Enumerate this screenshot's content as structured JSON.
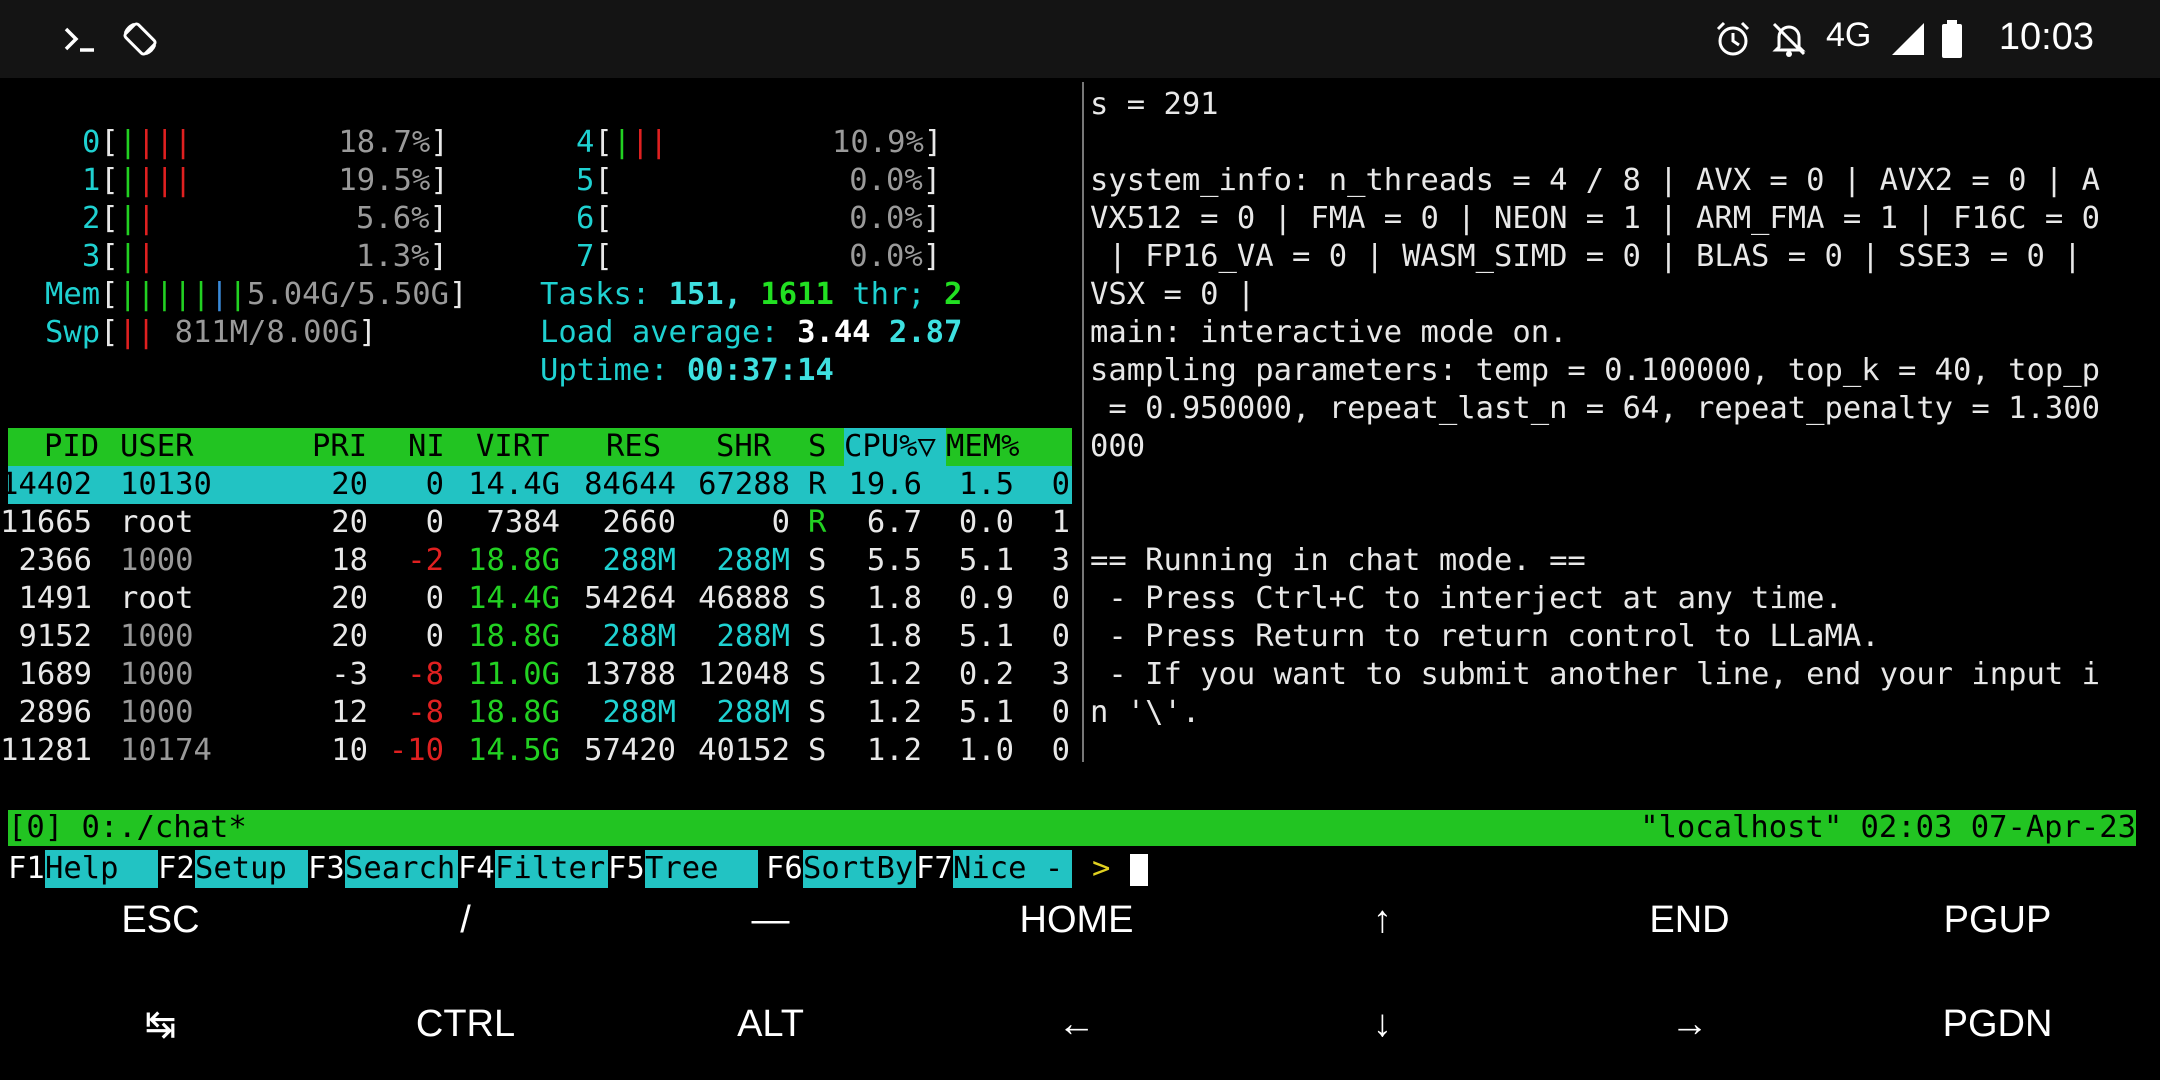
{
  "status_bar": {
    "left_icons": [
      "terminal-icon",
      "screen-rotate-icon"
    ],
    "right_icons": [
      "alarm-icon",
      "notifications-off-icon",
      "signal-icon",
      "battery-icon"
    ],
    "network": "4G",
    "time": "10:03"
  },
  "htop": {
    "cpus": [
      {
        "id": "0",
        "bars": "||||",
        "pct": "18.7%"
      },
      {
        "id": "1",
        "bars": "||||",
        "pct": "19.5%"
      },
      {
        "id": "2",
        "bars": "||",
        "pct": "5.6%"
      },
      {
        "id": "3",
        "bars": "||",
        "pct": "1.3%"
      },
      {
        "id": "4",
        "bars": "|||",
        "pct": "10.9%"
      },
      {
        "id": "5",
        "bars": "",
        "pct": "0.0%"
      },
      {
        "id": "6",
        "bars": "",
        "pct": "0.0%"
      },
      {
        "id": "7",
        "bars": "",
        "pct": "0.0%"
      }
    ],
    "mem": {
      "label": "Mem",
      "bars": "|||||||",
      "value": "5.04G/5.50G"
    },
    "swp": {
      "label": "Swp",
      "bars": "||",
      "value": "811M/8.00G"
    },
    "tasks": {
      "label": "Tasks:",
      "count": "151,",
      "thr": "1611",
      "thr_label": "thr;",
      "running": "2"
    },
    "load": {
      "label": "Load average:",
      "v1": "3.44",
      "v2": "2.87"
    },
    "uptime": {
      "label": "Uptime:",
      "value": "00:37:14"
    },
    "columns": [
      "PID",
      "USER",
      "PRI",
      "NI",
      "VIRT",
      "RES",
      "SHR",
      "S",
      "CPU%▽",
      "MEM%"
    ],
    "rows": [
      [
        "14402",
        "10130",
        "20",
        "0",
        "14.4G",
        "84644",
        "67288",
        "R",
        "19.6",
        "1.5",
        "0"
      ],
      [
        "11665",
        "root",
        "20",
        "0",
        "7384",
        "2660",
        "0",
        "R",
        "6.7",
        "0.0",
        "1"
      ],
      [
        "2366",
        "1000",
        "18",
        "-2",
        "18.8G",
        "288M",
        "288M",
        "S",
        "5.5",
        "5.1",
        "3"
      ],
      [
        "1491",
        "root",
        "20",
        "0",
        "14.4G",
        "54264",
        "46888",
        "S",
        "1.8",
        "0.9",
        "0"
      ],
      [
        "9152",
        "1000",
        "20",
        "0",
        "18.8G",
        "288M",
        "288M",
        "S",
        "1.8",
        "5.1",
        "0"
      ],
      [
        "1689",
        "1000",
        "-3",
        "-8",
        "11.0G",
        "13788",
        "12048",
        "S",
        "1.2",
        "0.2",
        "3"
      ],
      [
        "2896",
        "1000",
        "12",
        "-8",
        "18.8G",
        "288M",
        "288M",
        "S",
        "1.2",
        "5.1",
        "0"
      ],
      [
        "11281",
        "10174",
        "10",
        "-10",
        "14.5G",
        "57420",
        "40152",
        "S",
        "1.2",
        "1.0",
        "0"
      ]
    ],
    "fkeys": [
      {
        "key": "F1",
        "label": "Help  "
      },
      {
        "key": "F2",
        "label": "Setup "
      },
      {
        "key": "F3",
        "label": "Search"
      },
      {
        "key": "F4",
        "label": "Filter"
      },
      {
        "key": "F5",
        "label": "Tree  "
      },
      {
        "key": "F6",
        "label": "SortBy"
      },
      {
        "key": "F7",
        "label": "Nice -"
      }
    ]
  },
  "llama_output": {
    "lines": [
      "s = 291",
      "",
      "system_info: n_threads = 4 / 8 | AVX = 0 | AVX2 = 0 | A",
      "VX512 = 0 | FMA = 0 | NEON = 1 | ARM_FMA = 1 | F16C = 0",
      " | FP16_VA = 0 | WASM_SIMD = 0 | BLAS = 0 | SSE3 = 0 |",
      "VSX = 0 |",
      "main: interactive mode on.",
      "sampling parameters: temp = 0.100000, top_k = 40, top_p",
      " = 0.950000, repeat_last_n = 64, repeat_penalty = 1.300",
      "000",
      "",
      "",
      "== Running in chat mode. ==",
      " - Press Ctrl+C to interject at any time.",
      " - Press Return to return control to LLaMA.",
      " - If you want to submit another line, end your input i",
      "n '\\'."
    ],
    "prompt": ">"
  },
  "tmux": {
    "left": "[0] 0:./chat*",
    "right": "\"localhost\" 02:03 07-Apr-23"
  },
  "extra_keys": {
    "row1": [
      "ESC",
      "/",
      "—",
      "HOME",
      "↑",
      "END",
      "PGUP"
    ],
    "row2": [
      "↹",
      "CTRL",
      "ALT",
      "←",
      "↓",
      "→",
      "PGDN"
    ]
  }
}
